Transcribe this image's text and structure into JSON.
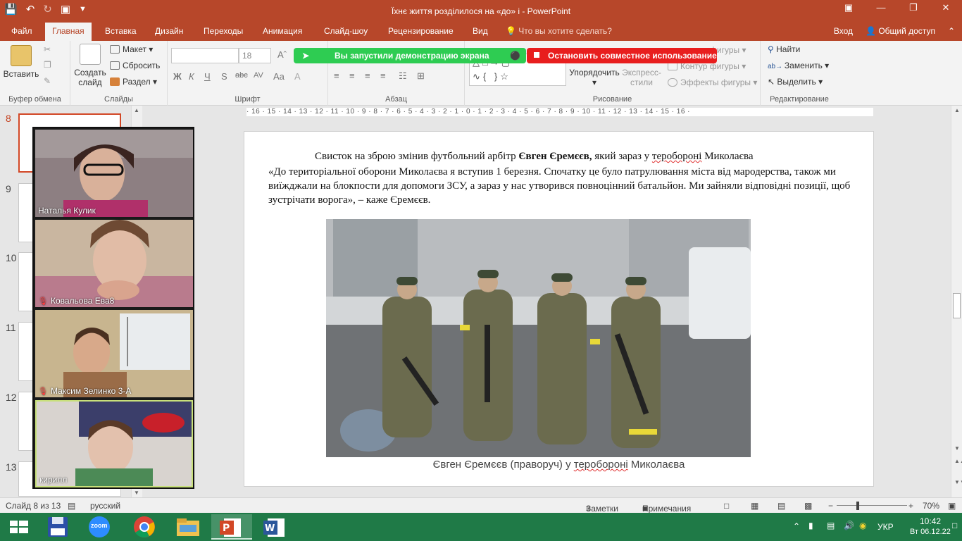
{
  "window": {
    "title": "Їхнє життя розділилося на «до» і - PowerPoint"
  },
  "tabs": [
    "Файл",
    "Главная",
    "Вставка",
    "Дизайн",
    "Переходы",
    "Анимация",
    "Слайд-шоу",
    "Рецензирование",
    "Вид"
  ],
  "tell_me": "Что вы хотите сделать?",
  "account": {
    "signin": "Вход",
    "share": "Общий доступ"
  },
  "ribbon": {
    "clipboard": {
      "paste": "Вставить",
      "label": "Буфер обмена"
    },
    "slides": {
      "new_slide": "Создать слайд",
      "layout": "Макет",
      "reset": "Сбросить",
      "section": "Раздел",
      "label": "Слайды"
    },
    "font": {
      "size": "18",
      "label": "Шрифт"
    },
    "paragraph": {
      "label": "Абзац"
    },
    "drawing": {
      "arrange": "Упорядочить",
      "quick_styles": "Экспресс-стили",
      "shape_fill": "фигуры",
      "shape_outline": "Контур фигуры",
      "shape_effects": "Эффекты фигуры",
      "label": "Рисование"
    },
    "editing": {
      "find": "Найти",
      "replace": "Заменить",
      "select": "Выделить",
      "label": "Редактирование"
    }
  },
  "banners": {
    "sharing": "Вы запустили демонстрацию экрана",
    "stop": "Остановить совместное использование"
  },
  "thumbnails": [
    "8",
    "9",
    "10",
    "11",
    "12",
    "13"
  ],
  "zoom_participants": [
    {
      "name": "Наталья Кулик",
      "muted": false
    },
    {
      "name": "Ковальова Ева8",
      "muted": true
    },
    {
      "name": "Максим Зелинко 3-А",
      "muted": true
    },
    {
      "name": "кирилл",
      "muted": false
    }
  ],
  "ruler_text": "· 16 · 15 · 14 · 13 · 12 · 11 · 10 · 9 · 8 · 7 · 6 · 5 · 4 · 3 · 2 · 1 · 0 · 1 · 2 · 3 · 4 · 5 · 6 · 7 · 8 · 9 · 10 · 11 · 12 · 13 · 14 · 15 · 16 ·",
  "slide": {
    "para1_prefix": "Свисток на зброю змінив футбольний арбітр ",
    "para1_bold": "Євген Єремєєв,",
    "para1_mid": " який зараз у ",
    "para1_spell": "теробороні",
    "para1_suffix": " Миколаєва",
    "quote": "«До територіальної оборони Миколаєва я вступив 1 березня. Спочатку це було патрулювання міста від мародерства, також ми виїжджали на блокпости для допомоги ЗСУ, а зараз у нас утворився повноцінний батальйон. Ми зайняли відповідні позиції, щоб зустрічати ворога», – каже Єремєєв.",
    "caption_a": "Євген Єремєєв (праворуч) у ",
    "caption_spell": "теробороні",
    "caption_b": " Миколаєва"
  },
  "status": {
    "slide_info": "Слайд 8 из 13",
    "language": "русский",
    "notes": "Заметки",
    "comments": "Примечания",
    "zoom": "70%"
  },
  "taskbar": {
    "lang": "УКР",
    "time": "10:42",
    "date": "Вт 06.12.22",
    "zoom_app": "zoom"
  },
  "colors": {
    "accent": "#b7472a",
    "selected_thumb": "#d24726",
    "banner_green": "#2ecc52",
    "banner_red": "#e81e1e",
    "taskbar": "#1f7a47"
  }
}
